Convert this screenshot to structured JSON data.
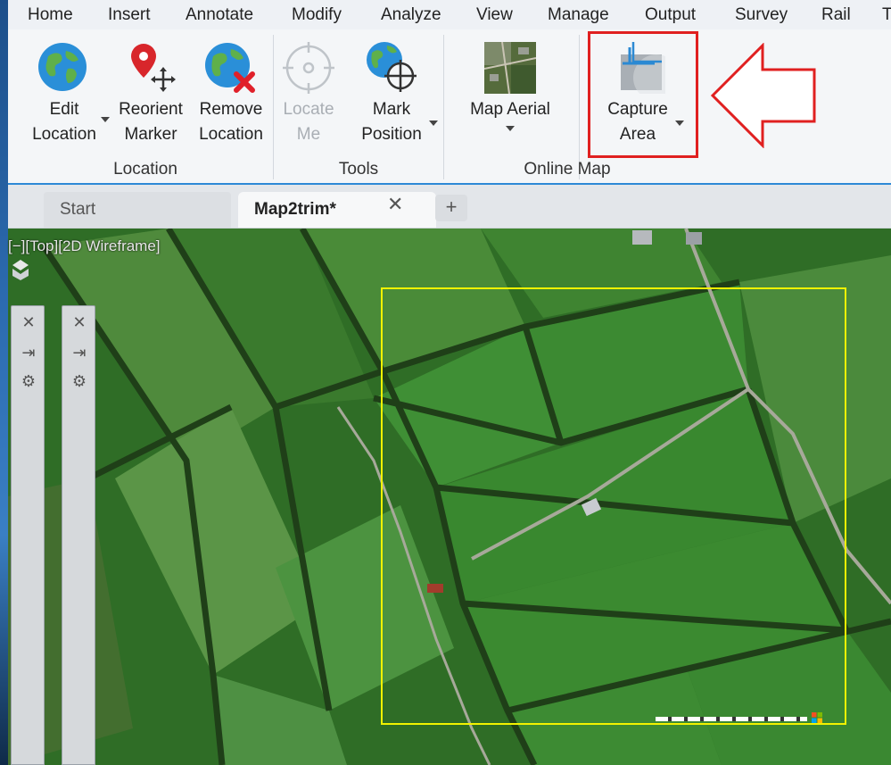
{
  "ribbon_tabs": [
    "Home",
    "Insert",
    "Annotate",
    "Modify",
    "Analyze",
    "View",
    "Manage",
    "Output",
    "Survey",
    "Rail",
    "Tr"
  ],
  "ribbon": {
    "location_group": {
      "label": "Location",
      "edit_location": "Edit\nLocation",
      "reorient_marker": "Reorient\nMarker",
      "remove_location": "Remove\nLocation"
    },
    "tools_group": {
      "label": "Tools",
      "locate_me": "Locate\nMe",
      "mark_position": "Mark\nPosition"
    },
    "online_map_group": {
      "label": "Online Map",
      "map_aerial": "Map Aerial",
      "capture_area": "Capture\nArea"
    }
  },
  "file_tabs": {
    "start": "Start",
    "active": "Map2trim*",
    "close_glyph": "✕",
    "new_glyph": "+"
  },
  "viewport": {
    "label": "[−][Top][2D Wireframe]"
  },
  "palettes": {
    "close_glyph": "✕",
    "autohide_glyph": "⇥",
    "settings_glyph": "⚙"
  },
  "colors": {
    "highlight": "#e02020",
    "capture_frame": "#f2f200",
    "ribbon_accent": "#2d89d6"
  },
  "icons": {
    "globe": "globe-icon",
    "pin_move": "pin-move-icon",
    "globe_remove": "globe-remove-icon",
    "locate": "crosshair-icon",
    "mark": "globe-crosshair-icon",
    "aerial": "aerial-thumbnail-icon",
    "capture": "capture-area-icon",
    "arrow": "left-arrow-annotation"
  }
}
